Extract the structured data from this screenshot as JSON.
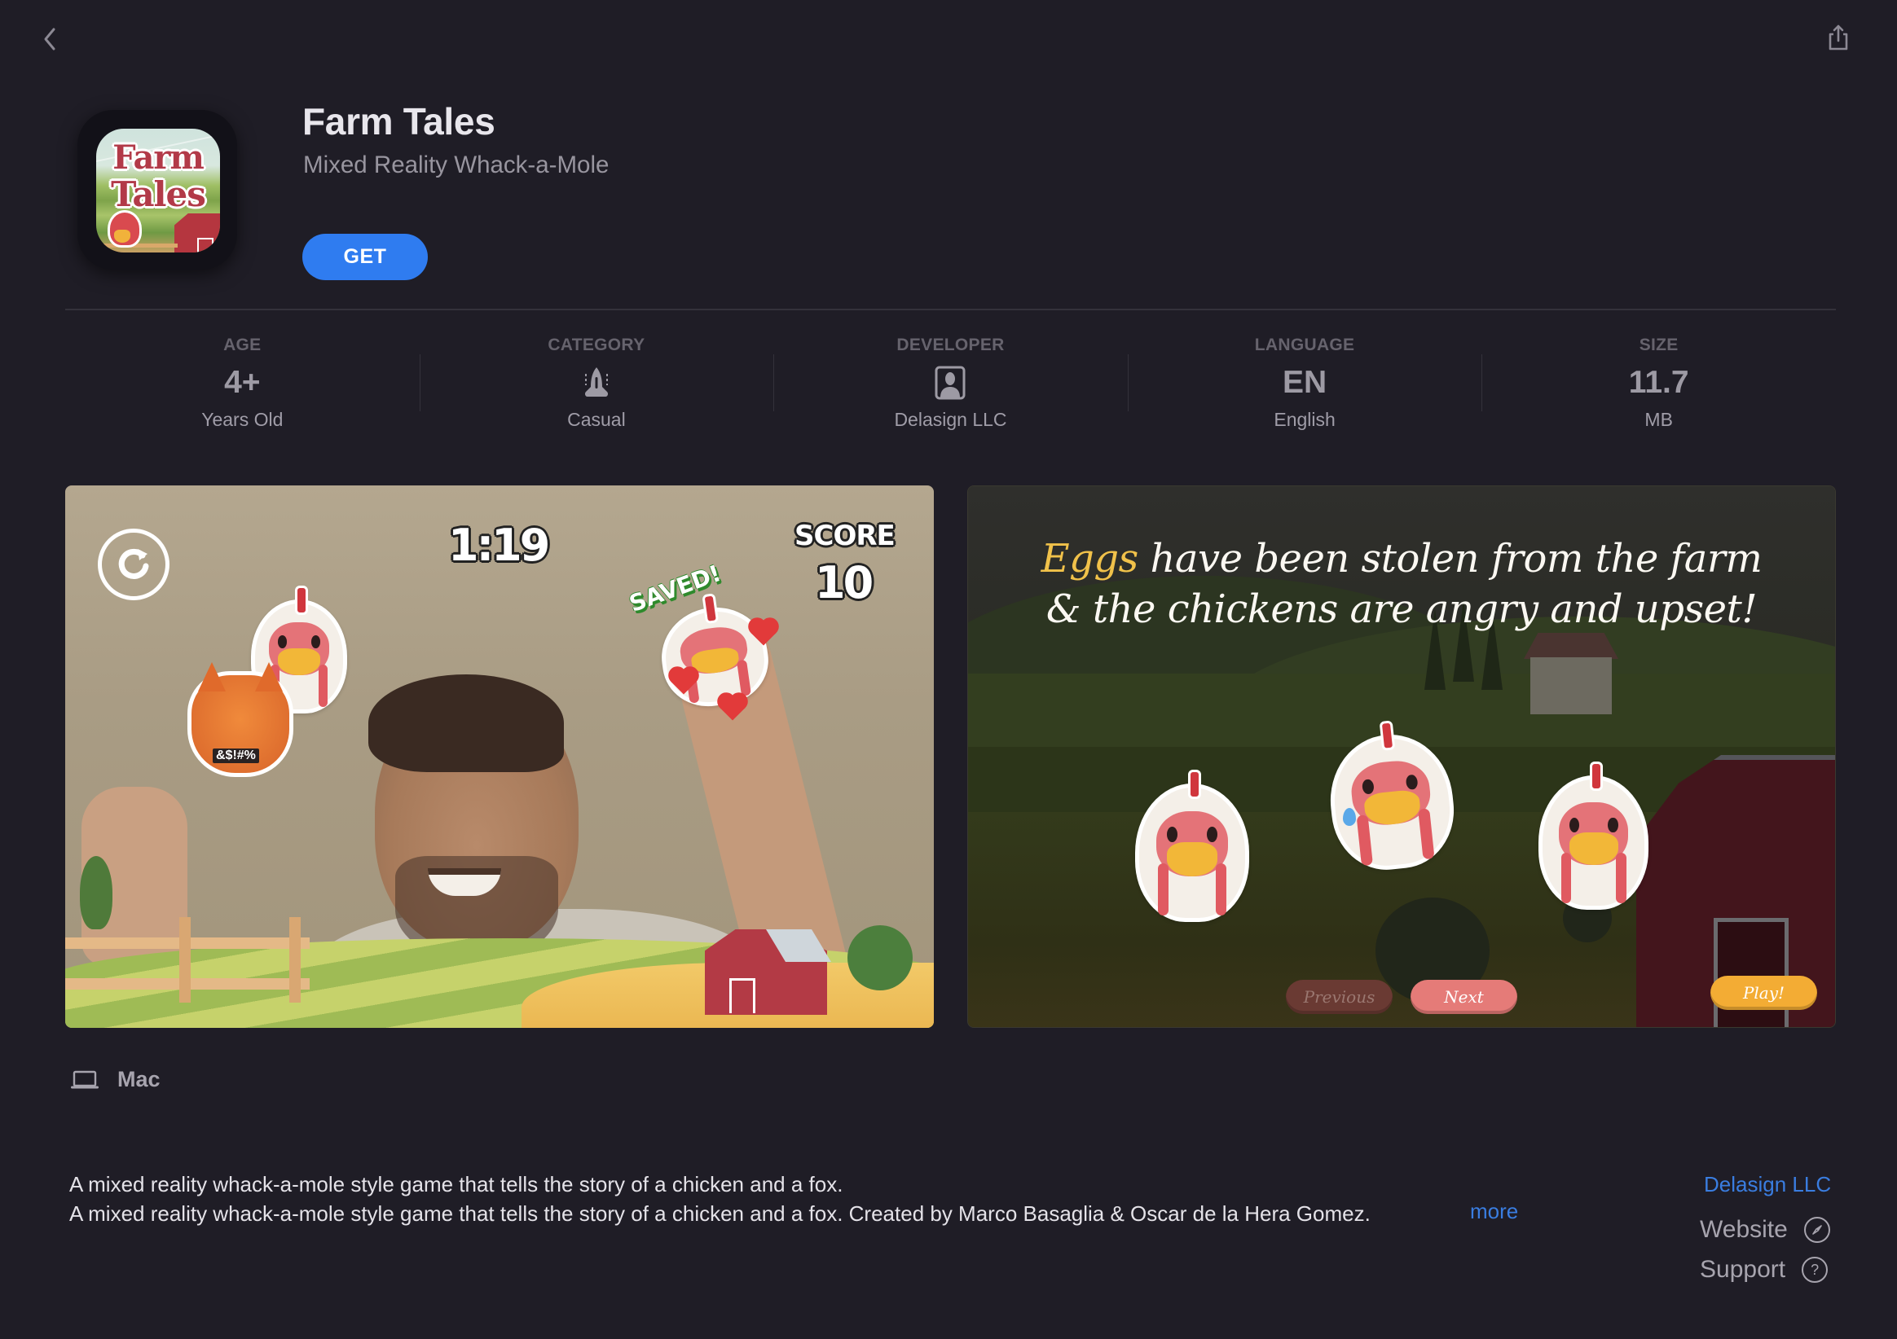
{
  "nav": {
    "back_icon": "chevron-left-icon",
    "share_icon": "share-icon"
  },
  "app": {
    "name": "Farm Tales",
    "subtitle": "Mixed Reality Whack-a-Mole",
    "icon_text_line1": "Farm",
    "icon_text_line2": "Tales",
    "get_label": "GET",
    "accent_color": "#2f7cf0"
  },
  "info": [
    {
      "label": "AGE",
      "value": "4+",
      "sub": "Years Old"
    },
    {
      "label": "CATEGORY",
      "value_icon": "rocket-icon",
      "sub": "Casual"
    },
    {
      "label": "DEVELOPER",
      "value_icon": "person-badge-icon",
      "sub": "Delasign LLC"
    },
    {
      "label": "LANGUAGE",
      "value": "EN",
      "sub": "English"
    },
    {
      "label": "SIZE",
      "value": "11.7",
      "sub": "MB"
    }
  ],
  "screenshots": [
    {
      "timer": "1:19",
      "score_label": "SCORE",
      "score_value": "10",
      "saved_badge": "SAVED!",
      "fox_sign": "&$!#%"
    },
    {
      "caption_accent": "Eggs",
      "caption_line1_rest": " have been stolen from the farm",
      "caption_line2": "& the chickens are angry and upset!",
      "prev_label": "Previous",
      "next_label": "Next",
      "play_label": "Play!"
    }
  ],
  "platform": {
    "icon": "laptop-icon",
    "label": "Mac"
  },
  "description": {
    "line1": "A mixed reality whack-a-mole style game that tells the story of a chicken and a fox.",
    "line2": "A mixed reality whack-a-mole style game that tells the story of a chicken and a fox. Created by Marco Basaglia & Oscar de la Hera Gomez.",
    "more_label": "more"
  },
  "side_links": {
    "developer": "Delasign LLC",
    "website": "Website",
    "support": "Support",
    "support_glyph": "?"
  },
  "colors": {
    "background": "#1f1d26",
    "link": "#3a7de0",
    "muted_text": "#a7a4ae"
  }
}
